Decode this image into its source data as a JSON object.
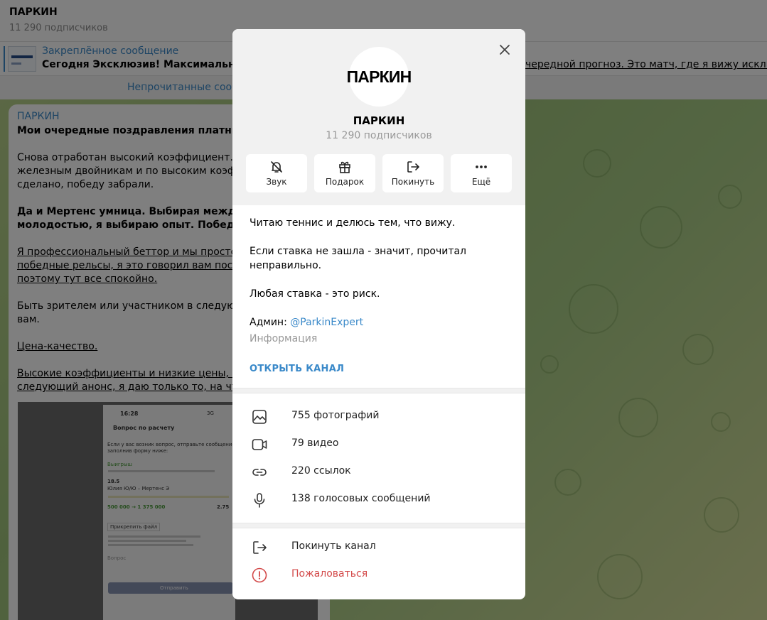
{
  "channel": {
    "title": "ПАРКИН",
    "subscribers": "11 290 подписчиков"
  },
  "pinned": {
    "label": "Закреплённое сообщение",
    "text_start": "Сегодня Эксклюзив! Максимальная у",
    "text_end": "чередной прогноз. Это матч, где я вижу исключите"
  },
  "unread_label": "Непрочитанные сооб",
  "message": {
    "author": "ПАРКИН",
    "lines": [
      "Мои очередные поздравления платникам",
      "Снова отработан высокий коэффициент. То",
      "железным двойникам и по высоким коэффи",
      "сделано, победу забрали.",
      "Да и Мертенс умница. Выбирая между опы",
      "молодостью, я выбираю опыт. Победа Эли",
      "Я профессиональный беттор и мы просто в",
      "победные рельсы, я это говорил вам после",
      "поэтому тут все спокойно.",
      "Быть зрителем или участником в следующи",
      "вам.",
      "Цена-качество.",
      "Высокие коэффициенты и низкие цены, все",
      "следующий анонс, я даю только то, на что"
    ],
    "screenshot": {
      "time": "16:28",
      "status": "3G",
      "heading": "Вопрос по расчету",
      "line1": "Если у вас возник вопрос, отправьте сообщение,",
      "line2": "заполнив форму ниже:",
      "won": "Выигрыш",
      "odds": "18.5",
      "match": "Юлия Ю/Ю – Мертенс Э",
      "amount": "500 000 → 1 375 000",
      "coef": "2.75",
      "attach": "Прикрепить файл",
      "placeholder": "Вопрос",
      "send": "Отправить"
    }
  },
  "dialog": {
    "avatar_text": "ПАРКИН",
    "name": "ПАРКИН",
    "subscribers": "11 290 подписчиков",
    "actions": [
      {
        "label": "Звук",
        "icon": "bell-muted-icon"
      },
      {
        "label": "Подарок",
        "icon": "gift-icon"
      },
      {
        "label": "Покинуть",
        "icon": "leave-icon"
      },
      {
        "label": "Ещё",
        "icon": "more-icon"
      }
    ],
    "description": [
      "Читаю теннис и делюсь тем, что вижу.",
      "Если ставка не зашла - значит, прочитал",
      "неправильно.",
      "Любая ставка - это риск."
    ],
    "admin_label": "Админ:",
    "admin_link": "@ParkinExpert",
    "info_label": "Информация",
    "open_channel": "ОТКРЫТЬ КАНАЛ",
    "media": [
      {
        "label": "755 фотографий",
        "icon": "photo-icon"
      },
      {
        "label": "79 видео",
        "icon": "video-icon"
      },
      {
        "label": "220 ссылок",
        "icon": "link-icon"
      },
      {
        "label": "138 голосовых сообщений",
        "icon": "microphone-icon"
      }
    ],
    "leave_channel": "Покинуть канал",
    "report": "Пожаловаться",
    "colors": {
      "accent": "#3a89c9",
      "danger": "#d34a4a"
    }
  }
}
